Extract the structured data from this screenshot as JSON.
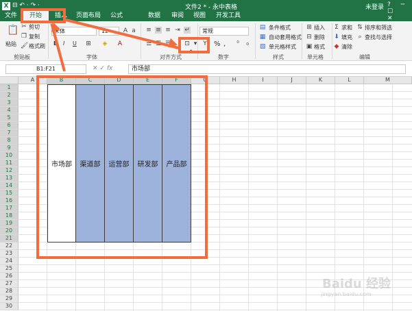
{
  "titlebar": {
    "app_logo": "X",
    "qat": "⊟ ↶ · ↷ ·",
    "doc_title": "文件2 * - 永中表格",
    "login": "未登录",
    "window_buttons": "? ─ ☐ ✕"
  },
  "ribbon_tabs": [
    "文件",
    "开始",
    "插入",
    "页面布局",
    "公式",
    "数据",
    "审阅",
    "视图",
    "开发工具"
  ],
  "ribbon": {
    "clipboard": {
      "paste": "粘贴",
      "cut": "剪切",
      "copy": "复制",
      "format_painter": "格式刷",
      "label": "剪贴板"
    },
    "font": {
      "name": "宋体",
      "size": "12",
      "bold": "B",
      "italic": "I",
      "underline": "U",
      "label": "字体"
    },
    "alignment": {
      "label": "对齐方式"
    },
    "number": {
      "format": "常规",
      "percent": "%",
      "comma": ",",
      "label": "数字"
    },
    "styles": {
      "conditional": "条件格式",
      "table_format": "自动套用格式",
      "cell_style": "单元格样式",
      "label": "样式"
    },
    "cells": {
      "insert": "插入",
      "delete": "删除",
      "format": "格式",
      "label": "单元格"
    },
    "editing": {
      "sum": "求和",
      "sort_filter": "排序和筛选",
      "fill": "填充",
      "find_select": "查找与选择",
      "clear": "清除",
      "label": "编辑"
    }
  },
  "formula_bar": {
    "name_box": "B1:F21",
    "fx": "fx",
    "content": "市场部"
  },
  "columns": [
    "A",
    "B",
    "C",
    "D",
    "E",
    "F",
    "G",
    "H",
    "I",
    "J",
    "K",
    "L",
    "M"
  ],
  "rows": [
    "1",
    "2",
    "3",
    "4",
    "5",
    "6",
    "7",
    "8",
    "9",
    "10",
    "11",
    "12",
    "13",
    "14",
    "15",
    "16",
    "17",
    "18",
    "19",
    "20",
    "21",
    "22",
    "23",
    "24",
    "25",
    "26",
    "27",
    "28",
    "29",
    "30"
  ],
  "merged_cells": [
    "市场部",
    "渠道部",
    "运营部",
    "研发部",
    "产品部"
  ],
  "watermark": {
    "text": "Baidu 经验",
    "sub": "jingyan.baidu.com"
  },
  "colors": {
    "accent": "#217346",
    "selection": "#9db3dc",
    "annotation": "#f26c3d"
  }
}
